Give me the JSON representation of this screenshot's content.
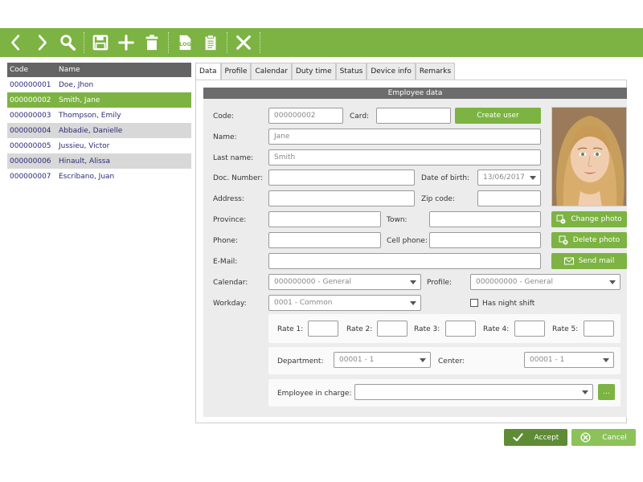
{
  "toolbar": {
    "icons": [
      "back-icon",
      "forward-icon",
      "search-icon",
      "save-icon",
      "add-icon",
      "delete-icon",
      "log-icon",
      "report-icon",
      "close-icon"
    ]
  },
  "employees": {
    "headers": {
      "code": "Code",
      "name": "Name"
    },
    "rows": [
      {
        "code": "000000001",
        "name": "Doe, Jhon"
      },
      {
        "code": "000000002",
        "name": "Smith, Jane"
      },
      {
        "code": "000000003",
        "name": "Thompson, Emily"
      },
      {
        "code": "000000004",
        "name": "Abbadie, Danielle"
      },
      {
        "code": "000000005",
        "name": "Jussieu, Victor"
      },
      {
        "code": "000000006",
        "name": "Hinault, Alissa"
      },
      {
        "code": "000000007",
        "name": "Escribano, Juan"
      }
    ],
    "selected_index": 1
  },
  "tabs": [
    "Data",
    "Profile",
    "Calendar",
    "Duty time",
    "Status",
    "Device info",
    "Remarks"
  ],
  "form": {
    "title": "Employee data",
    "code_label": "Code:",
    "code_value": "000000002",
    "card_label": "Card:",
    "card_value": "",
    "create_user": "Create user",
    "name_label": "Name:",
    "name_value": "Jane",
    "lastname_label": "Last name:",
    "lastname_value": "Smith",
    "docnum_label": "Doc. Number:",
    "docnum_value": "",
    "dob_label": "Date of birth:",
    "dob_value": "13/06/2017",
    "address_label": "Address:",
    "address_value": "",
    "zip_label": "Zip code:",
    "zip_value": "",
    "province_label": "Province:",
    "province_value": "",
    "town_label": "Town:",
    "town_value": "",
    "phone_label": "Phone:",
    "phone_value": "",
    "cell_label": "Cell phone:",
    "cell_value": "",
    "email_label": "E-Mail:",
    "email_value": "",
    "change_photo": "Change photo",
    "delete_photo": "Delete photo",
    "send_mail": "Send mail",
    "calendar_label": "Calendar:",
    "calendar_value": "000000000 - General",
    "profile_label": "Profile:",
    "profile_value": "000000000 - General",
    "workday_label": "Workday:",
    "workday_value": "0001 - Common",
    "night_shift_label": "Has night shift",
    "night_shift_checked": false,
    "rate_labels": [
      "Rate 1:",
      "Rate 2:",
      "Rate 3:",
      "Rate 4:",
      "Rate 5:"
    ],
    "rate_values": [
      "",
      "",
      "",
      "",
      ""
    ],
    "department_label": "Department:",
    "department_value": "00001 - 1",
    "center_label": "Center:",
    "center_value": "00001 - 1",
    "in_charge_label": "Employee in charge:",
    "in_charge_value": "",
    "ellipsis": "..."
  },
  "footer": {
    "accept": "Accept",
    "cancel": "Cancel"
  },
  "colors": {
    "accent": "#7cb342",
    "accent_dark": "#5e8c35",
    "list_header": "#646464",
    "panel_title": "#6c6c6c"
  }
}
